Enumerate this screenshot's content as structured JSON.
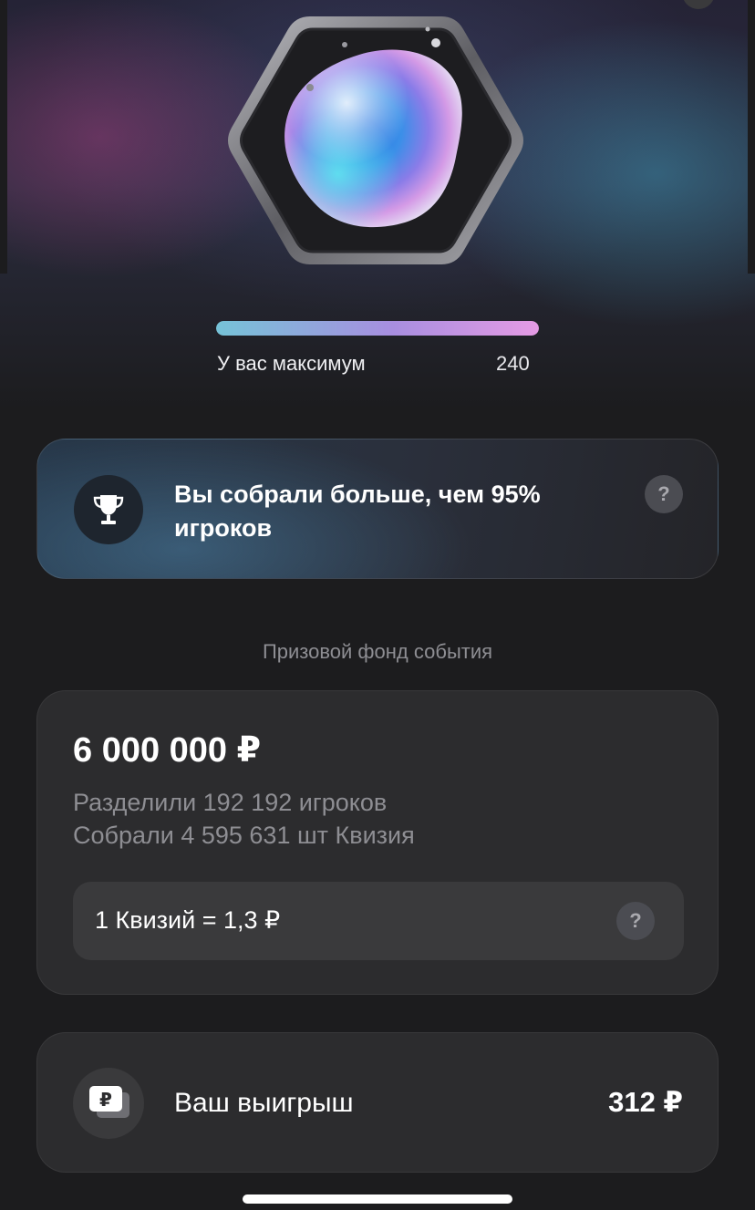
{
  "level": {
    "progress_fraction": 1.0,
    "max_label": "У вас максимум",
    "max_value": "240"
  },
  "achievement": {
    "text": "Вы собрали больше, чем 95% игроков",
    "help_glyph": "?",
    "icon": "trophy-icon"
  },
  "prize_fund": {
    "section_title": "Призовой фонд события",
    "amount": "6 000 000 ₽",
    "shared_by": "Разделили 192 192 игроков",
    "collected": "Собрали 4 595 631 шт Квизия",
    "rate": "1 Квизий = 1,3 ₽",
    "rate_help_glyph": "?"
  },
  "winnings": {
    "label": "Ваш выигрыш",
    "value": "312 ₽",
    "icon_glyph": "₽",
    "icon": "ruble-card-icon"
  },
  "colors": {
    "background": "#1c1c1e",
    "card": "#2c2c2e",
    "progress_start": "#76c3d8",
    "progress_end": "#e59be4"
  }
}
